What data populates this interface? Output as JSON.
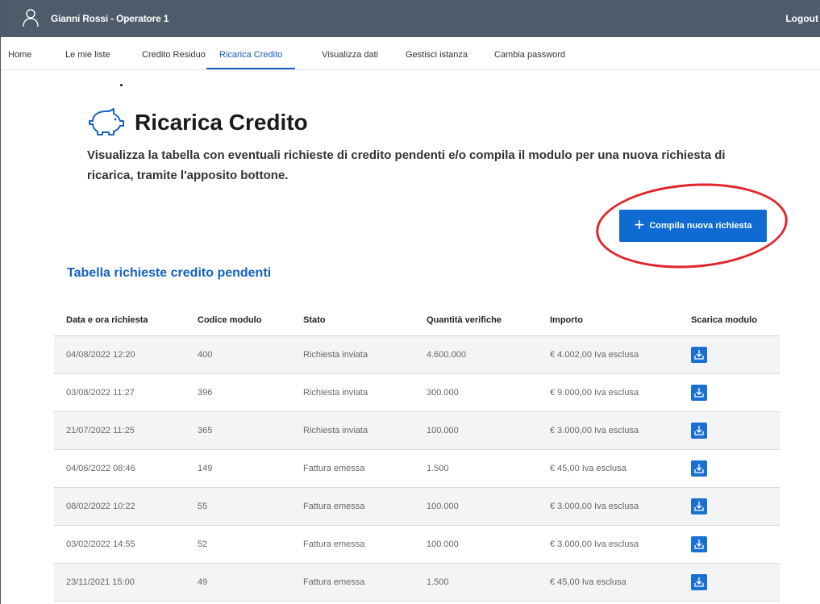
{
  "header": {
    "user_name": "Gianni Rossi - Operatore 1",
    "logout_label": "Logout"
  },
  "nav": {
    "items": [
      {
        "label": "Home"
      },
      {
        "label": "Le mie liste"
      },
      {
        "label": "Credito Residuo"
      },
      {
        "label": "Ricarica Credito",
        "active": true
      },
      {
        "label": "Visualizza dati"
      },
      {
        "label": "Gestisci istanza"
      },
      {
        "label": "Cambia password"
      }
    ]
  },
  "page": {
    "title": "Ricarica Credito",
    "icon": "piggy-bank-icon",
    "description": "Visualizza la tabella con eventuali richieste di credito pendenti e/o compila il modulo per una nuova richiesta di ricarica, tramite l'apposito bottone.",
    "new_request_button": "Compila nuova richiesta"
  },
  "table": {
    "title": "Tabella richieste credito pendenti",
    "headers": [
      "Data e ora richiesta",
      "Codice modulo",
      "Stato",
      "Quantità verifiche",
      "Importo",
      "Scarica modulo"
    ],
    "rows": [
      [
        "04/08/2022 12:20",
        "400",
        "Richiesta inviata",
        "4.600.000",
        "€ 4.002,00 Iva esclusa"
      ],
      [
        "03/08/2022 11:27",
        "396",
        "Richiesta inviata",
        "300.000",
        "€ 9.000,00 Iva esclusa"
      ],
      [
        "21/07/2022 11:25",
        "365",
        "Richiesta inviata",
        "100.000",
        "€ 3.000,00 Iva esclusa"
      ],
      [
        "04/06/2022 08:46",
        "149",
        "Fattura emessa",
        "1.500",
        "€ 45,00 Iva esclusa"
      ],
      [
        "08/02/2022 10:22",
        "55",
        "Fattura emessa",
        "100.000",
        "€ 3.000,00 Iva esclusa"
      ],
      [
        "03/02/2022 14:55",
        "52",
        "Fattura emessa",
        "100.000",
        "€ 3.000,00 Iva esclusa"
      ],
      [
        "23/11/2021 15:00",
        "49",
        "Fattura emessa",
        "1.500",
        "€ 45,00 Iva esclusa"
      ]
    ]
  },
  "colors": {
    "header_bg": "#4d5b6a",
    "accent": "#0f6ad1",
    "annotation": "#e0262b"
  }
}
